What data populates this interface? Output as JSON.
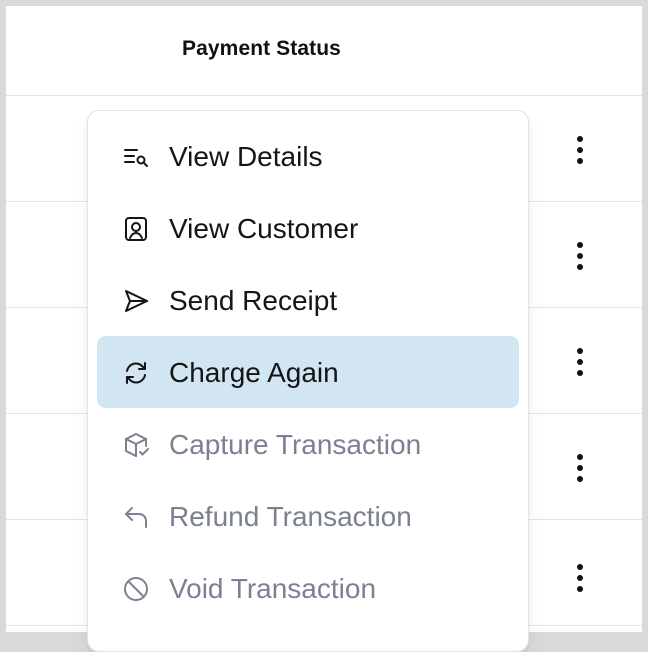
{
  "table": {
    "header": {
      "payment_status": "Payment Status"
    },
    "rows": [
      {
        "actions_icon": "vertical-ellipsis-icon"
      },
      {
        "actions_icon": "vertical-ellipsis-icon"
      },
      {
        "actions_icon": "vertical-ellipsis-icon"
      },
      {
        "actions_icon": "vertical-ellipsis-icon"
      },
      {
        "actions_icon": "vertical-ellipsis-icon"
      }
    ]
  },
  "menu": {
    "items": [
      {
        "label": "View Details",
        "icon": "list-search-icon",
        "state": "normal"
      },
      {
        "label": "View Customer",
        "icon": "customer-profile-icon",
        "state": "normal"
      },
      {
        "label": "Send Receipt",
        "icon": "send-icon",
        "state": "normal"
      },
      {
        "label": "Charge Again",
        "icon": "refresh-icon",
        "state": "active"
      },
      {
        "label": "Capture Transaction",
        "icon": "package-check-icon",
        "state": "disabled"
      },
      {
        "label": "Refund Transaction",
        "icon": "undo-arrow-icon",
        "state": "disabled"
      },
      {
        "label": "Void Transaction",
        "icon": "void-icon",
        "state": "disabled"
      }
    ]
  },
  "colors": {
    "active_item_background": "#d2e5f2",
    "normal_text": "#151515",
    "disabled_text": "#7b8190",
    "row_divider": "#e4e4e7"
  }
}
